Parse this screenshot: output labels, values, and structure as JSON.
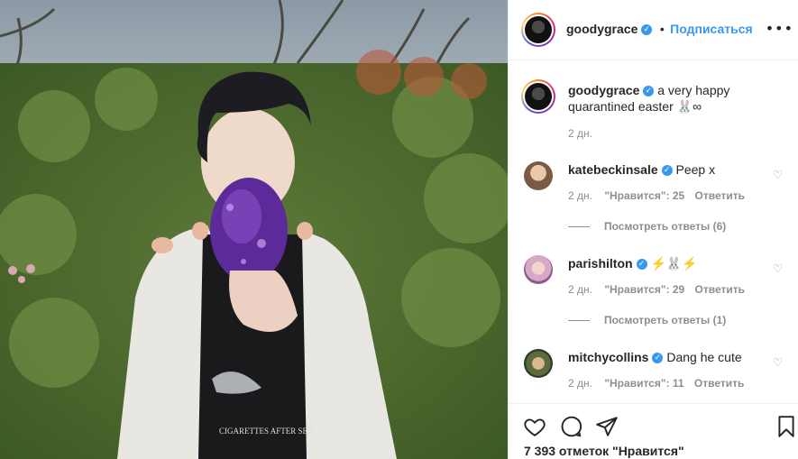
{
  "post": {
    "author": "goodygrace",
    "follow_label": "Подписаться",
    "dot_separator": "•",
    "more_glyph": "•••",
    "verified_glyph": "✓"
  },
  "caption": {
    "username": "goodygrace",
    "text": "a very happy quarantined easter 🐰∞",
    "time": "2 дн."
  },
  "comments": [
    {
      "username": "katebeckinsale",
      "text": "Peep x",
      "time": "2 дн.",
      "likes": "\"Нравится\": 25",
      "reply_label": "Ответить",
      "view_replies": "Посмотреть ответы (6)"
    },
    {
      "username": "parishilton",
      "text": "⚡️🐰⚡️",
      "time": "2 дн.",
      "likes": "\"Нравится\": 29",
      "reply_label": "Ответить",
      "view_replies": "Посмотреть ответы (1)"
    },
    {
      "username": "mitchycollins",
      "text": "Dang he cute",
      "time": "2 дн.",
      "likes": "\"Нравится\": 11",
      "reply_label": "Ответить"
    }
  ],
  "footer": {
    "likes_count": "7 393 отметок \"Нравится\""
  },
  "shirt_text": "CIGARETTES AFTER SEX",
  "icons": {
    "heart": "heart-icon",
    "comment": "comment-icon",
    "share": "share-icon",
    "save": "bookmark-icon",
    "more": "more-options-icon",
    "verified": "verified-badge-icon"
  },
  "colors": {
    "link_blue": "#3897f0",
    "verified_blue": "#3897f0",
    "muted_gray": "#8e8e8e",
    "text_dark": "#262626",
    "border": "#efefef"
  }
}
